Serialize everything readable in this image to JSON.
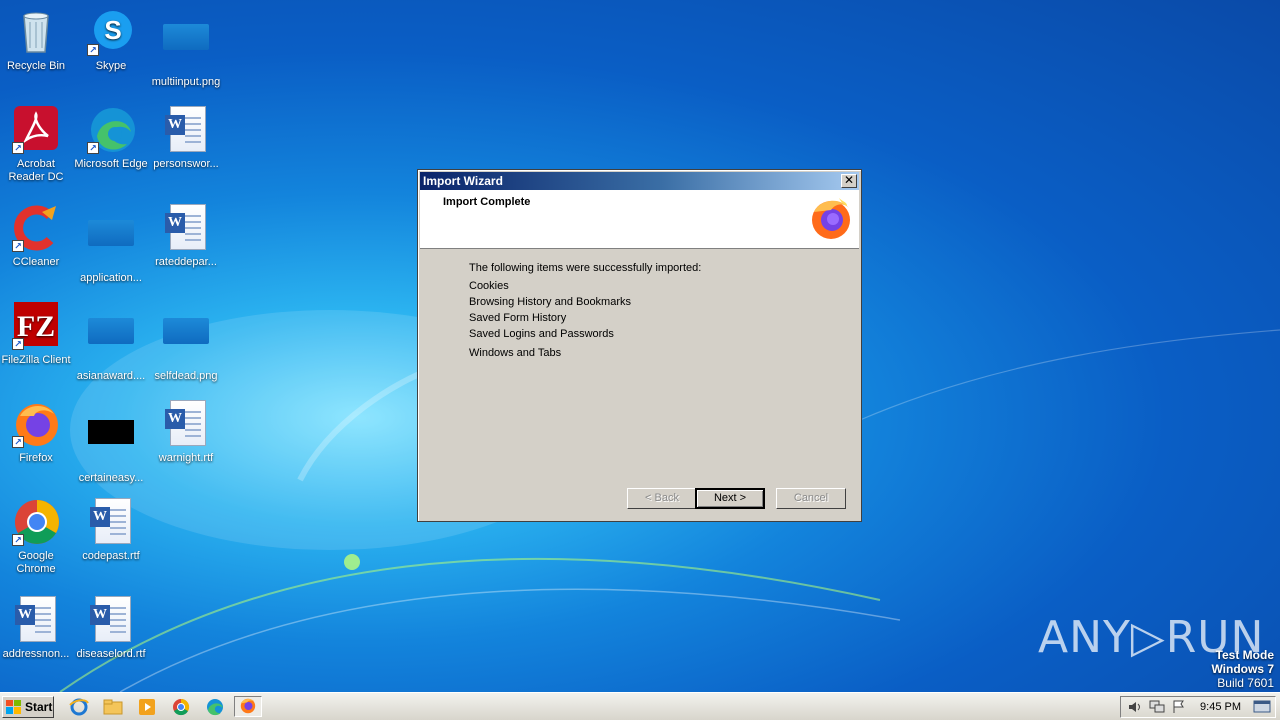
{
  "desktop": {
    "icons": [
      {
        "label": "Recycle Bin",
        "icon": "recycle-bin-icon"
      },
      {
        "label": "Skype",
        "icon": "skype-icon"
      },
      {
        "label": "multiinput.png",
        "icon": "image-file-icon"
      },
      {
        "label": "Acrobat Reader DC",
        "icon": "acrobat-icon"
      },
      {
        "label": "Microsoft Edge",
        "icon": "edge-icon"
      },
      {
        "label": "personswor...",
        "icon": "word-document-icon"
      },
      {
        "label": "CCleaner",
        "icon": "ccleaner-icon"
      },
      {
        "label": "application...",
        "icon": "image-file-icon"
      },
      {
        "label": "rateddepar...",
        "icon": "word-document-icon"
      },
      {
        "label": "FileZilla Client",
        "icon": "filezilla-icon"
      },
      {
        "label": "asianaward....",
        "icon": "image-file-icon"
      },
      {
        "label": "selfdead.png",
        "icon": "image-file-icon"
      },
      {
        "label": "Firefox",
        "icon": "firefox-icon"
      },
      {
        "label": "certaineasy...",
        "icon": "image-file-icon"
      },
      {
        "label": "warnight.rtf",
        "icon": "word-document-icon"
      },
      {
        "label": "Google Chrome",
        "icon": "chrome-icon"
      },
      {
        "label": "codepast.rtf",
        "icon": "word-document-icon"
      },
      {
        "label": "addressnon...",
        "icon": "word-document-icon"
      },
      {
        "label": "diseaselord.rtf",
        "icon": "word-document-icon"
      }
    ]
  },
  "dialog": {
    "title": "Import Wizard",
    "close_symbol": "✕",
    "header_title": "Import Complete",
    "intro": "The following items were successfully imported:",
    "items": [
      "Cookies",
      "Browsing History and Bookmarks",
      "Saved Form History",
      "Saved Logins and Passwords",
      "Windows and Tabs"
    ],
    "buttons": {
      "back": "< Back",
      "next": "Next >",
      "cancel": "Cancel"
    }
  },
  "watermark": {
    "text": "ANY▷RUN"
  },
  "system_notice": {
    "line1": "Test Mode",
    "line2": "Windows 7",
    "line3": "Build 7601"
  },
  "taskbar": {
    "start_label": "Start",
    "clock": "9:45 PM",
    "pinned": [
      "internet-explorer-icon",
      "explorer-folder-icon",
      "media-player-icon",
      "chrome-icon",
      "edge-icon",
      "firefox-icon"
    ]
  },
  "colors": {
    "dialog_face": "#d4d0c8",
    "titlebar_start": "#0a246a",
    "titlebar_end": "#a6caf0",
    "desktop_blue": "#1384dc"
  }
}
